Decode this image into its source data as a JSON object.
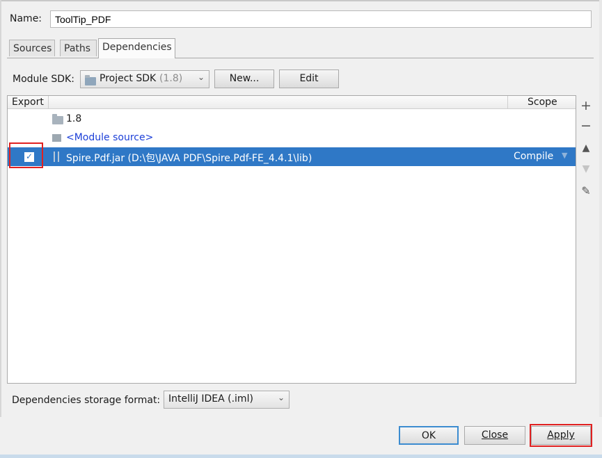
{
  "name": {
    "label": "Name:",
    "value": "ToolTip_PDF"
  },
  "tabs": [
    {
      "label": "Sources",
      "active": false
    },
    {
      "label": "Paths",
      "active": false
    },
    {
      "label": "Dependencies",
      "active": true
    }
  ],
  "module_sdk": {
    "label": "Module SDK:",
    "selected": "Project SDK",
    "selected_version": "(1.8)",
    "new_button": "New...",
    "edit_button": "Edit"
  },
  "table": {
    "headers": {
      "export": "Export",
      "scope": "Scope"
    },
    "rows": [
      {
        "name": "1.8",
        "scope": "",
        "export_checked": false,
        "selected": false
      },
      {
        "name": "<Module source>",
        "scope": "",
        "export_checked": false,
        "selected": false
      },
      {
        "name": "Spire.Pdf.jar (D:\\包\\JAVA PDF\\Spire.Pdf-FE_4.4.1\\lib)",
        "scope": "Compile",
        "export_checked": true,
        "selected": true
      }
    ]
  },
  "side_toolbar": [
    {
      "icon": "plus-icon",
      "enabled": true
    },
    {
      "icon": "minus-icon",
      "enabled": true
    },
    {
      "icon": "move-up-icon",
      "enabled": true
    },
    {
      "icon": "move-down-icon",
      "enabled": false
    },
    {
      "icon": "edit-pencil-icon",
      "enabled": true
    }
  ],
  "storage_format": {
    "label": "Dependencies storage format:",
    "selected": "IntelliJ IDEA (.iml)"
  },
  "buttons": {
    "ok": "OK",
    "close": "Close",
    "apply": "Apply"
  },
  "colors": {
    "selection": "#2f78c6",
    "highlight_box": "#e02020",
    "module_source_text": "#1c3fd8"
  }
}
